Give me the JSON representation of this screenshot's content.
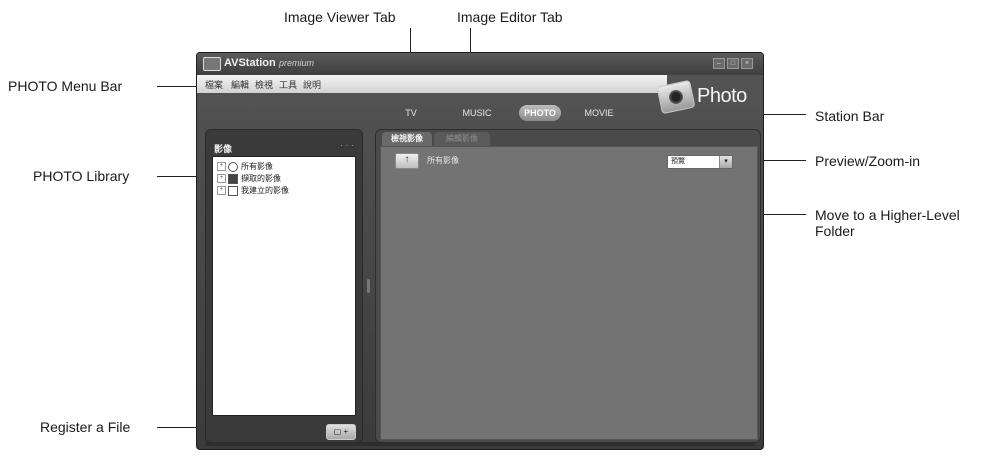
{
  "callouts": {
    "image_viewer_tab": "Image Viewer Tab",
    "image_editor_tab": "Image Editor Tab",
    "photo_menu_bar": "PHOTO Menu Bar",
    "station_bar": "Station Bar",
    "photo_library": "PHOTO Library",
    "preview_zoom": "Preview/Zoom-in",
    "move_higher": "Move to a Higher-Level Folder",
    "register_file": "Register a File"
  },
  "window": {
    "title": "AVStation",
    "title_suffix": "premium",
    "minimize_icon": "minimize-icon",
    "maximize_icon": "maximize-icon",
    "close_icon": "close-icon"
  },
  "menubar": {
    "items": [
      "檔案",
      "編輯",
      "檢視",
      "工具",
      "說明"
    ]
  },
  "badge": {
    "title": "Photo",
    "icon": "camera-icon"
  },
  "stationbar": {
    "tabs": [
      "TV",
      "MUSIC",
      "PHOTO",
      "MOVIE"
    ],
    "active": "PHOTO"
  },
  "library": {
    "header": "影像",
    "dots": "· · ·",
    "items": [
      "所有影像",
      "擷取的影像",
      "我建立的影像"
    ],
    "register_label": "▢ +"
  },
  "viewer": {
    "tabs": [
      "檢視影像",
      "編輯影像"
    ],
    "up_label": "↑",
    "path": "所有影像",
    "zoom_value": "預覽",
    "zoom_arrow": "▾"
  }
}
